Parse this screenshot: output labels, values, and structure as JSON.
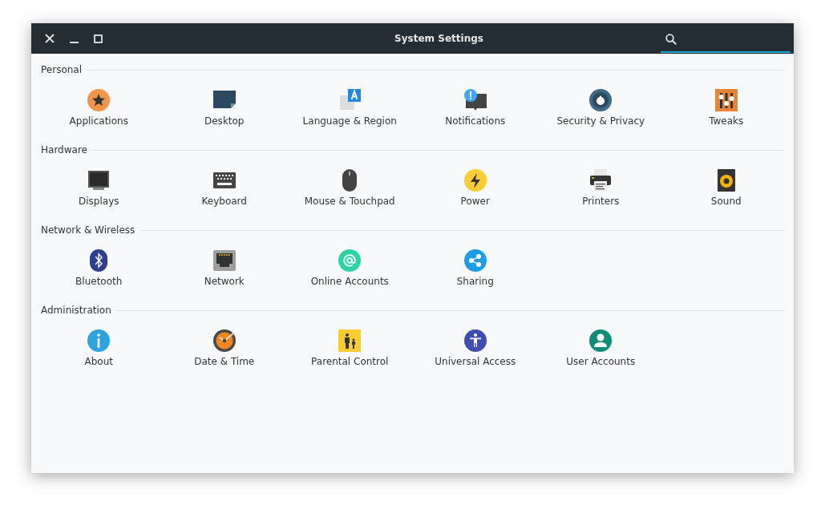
{
  "window": {
    "title": "System Settings"
  },
  "sections": [
    {
      "title": "Personal",
      "items": [
        {
          "label": "Applications",
          "kind": "applications"
        },
        {
          "label": "Desktop",
          "kind": "desktop"
        },
        {
          "label": "Language & Region",
          "kind": "language"
        },
        {
          "label": "Notifications",
          "kind": "notifications"
        },
        {
          "label": "Security & Privacy",
          "kind": "security"
        },
        {
          "label": "Tweaks",
          "kind": "tweaks"
        }
      ]
    },
    {
      "title": "Hardware",
      "items": [
        {
          "label": "Displays",
          "kind": "displays"
        },
        {
          "label": "Keyboard",
          "kind": "keyboard"
        },
        {
          "label": "Mouse & Touchpad",
          "kind": "mouse"
        },
        {
          "label": "Power",
          "kind": "power"
        },
        {
          "label": "Printers",
          "kind": "printers"
        },
        {
          "label": "Sound",
          "kind": "sound"
        }
      ]
    },
    {
      "title": "Network & Wireless",
      "items": [
        {
          "label": "Bluetooth",
          "kind": "bluetooth"
        },
        {
          "label": "Network",
          "kind": "network"
        },
        {
          "label": "Online Accounts",
          "kind": "online"
        },
        {
          "label": "Sharing",
          "kind": "sharing"
        }
      ]
    },
    {
      "title": "Administration",
      "items": [
        {
          "label": "About",
          "kind": "about"
        },
        {
          "label": "Date & Time",
          "kind": "datetime"
        },
        {
          "label": "Parental Control",
          "kind": "parental"
        },
        {
          "label": "Universal Access",
          "kind": "universal"
        },
        {
          "label": "User Accounts",
          "kind": "users"
        }
      ]
    }
  ]
}
